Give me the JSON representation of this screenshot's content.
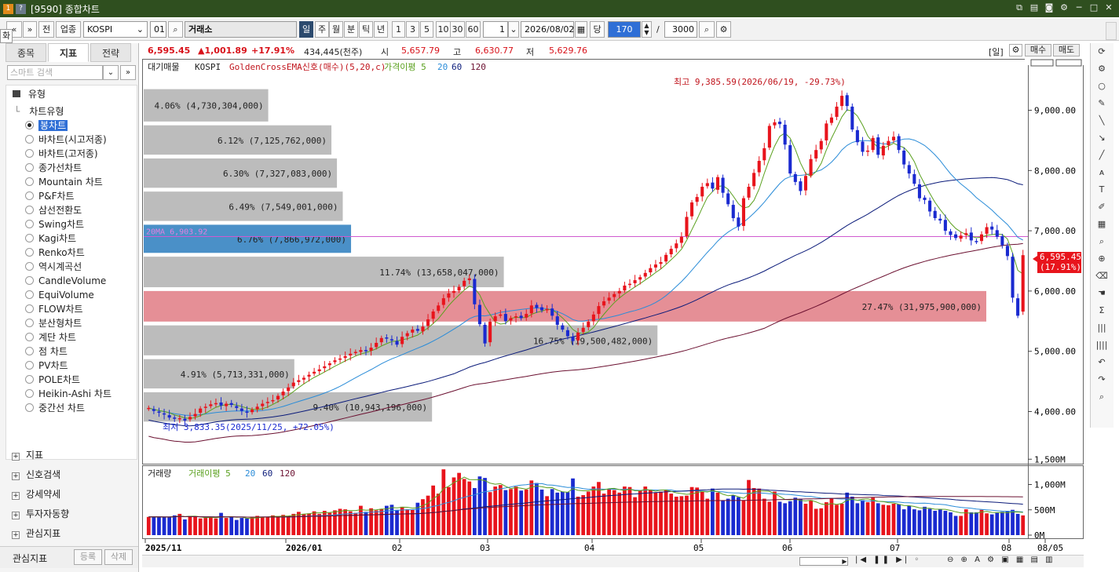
{
  "titlebar": {
    "badge1": "1",
    "badge2": "?",
    "title": "[9590] 종합차트"
  },
  "corner_tag": "화",
  "toolbar": {
    "nav_prev": "«",
    "nav_dropdown": "»",
    "btn_front": "전",
    "btn_industry": "업종",
    "symbol": "KOSPI",
    "symbol_no": "01",
    "exchange": "거래소",
    "periods": [
      "일",
      "주",
      "월",
      "분",
      "틱",
      "년"
    ],
    "intervals": [
      "1",
      "3",
      "5",
      "10",
      "30",
      "60"
    ],
    "count": "1",
    "date": "2026/08/02",
    "dang": "당",
    "view_count": "170",
    "slash": "/",
    "total": "3000"
  },
  "infobar": {
    "price": "6,595.45",
    "change": "▲1,001.89",
    "change_pct": "+17.91%",
    "volume": "434,445(천주)",
    "open_label": "시",
    "open": "5,657.79",
    "high_label": "고",
    "high": "6,630.77",
    "low_label": "저",
    "low": "5,629.76",
    "period_tag": "[일]",
    "buy_label": "매수",
    "sell_label": "매도"
  },
  "leftpanel": {
    "tabs": [
      "종목",
      "지표",
      "전략"
    ],
    "search_placeholder": "스마트 검색",
    "section_type": "유형",
    "tree_header": "차트유형",
    "chart_types": [
      "봉차트",
      "바차트(시고저종)",
      "바차트(고저종)",
      "종가선차트",
      "Mountain 차트",
      "P&F차트",
      "삼선전환도",
      "Swing차트",
      "Kagi차트",
      "Renko차트",
      "역시계곡선",
      "CandleVolume",
      "EquiVolume",
      "FLOW차트",
      "분산형차트",
      "계단 차트",
      "점 차트",
      "PV차트",
      "POLE차트",
      "Heikin-Ashi 차트",
      "중간선 차트"
    ],
    "sections": [
      "지표",
      "신호검색",
      "강세약세",
      "투자자동향",
      "관심지표"
    ],
    "fav_label": "관심지표",
    "btn_register": "등록",
    "btn_delete": "삭제"
  },
  "chart_data": [
    {
      "type": "candlestick",
      "legend": [
        "대기매물",
        "KOSPI",
        "GoldenCrossEMA신호(매수)(5,20,c)",
        "가격이평 5",
        "20",
        "60",
        "120"
      ],
      "colors": {
        "up": "#e8141c",
        "down": "#1a2ad0",
        "ma5": "#5aa01e",
        "ma20": "#2a8cd8",
        "ma60": "#0b1b7a",
        "ma120": "#6b1030",
        "hline": "#d05ad0"
      },
      "y_ticks": [
        "9,000.00",
        "8,000.00",
        "7,000.00",
        "6,000.00",
        "5,000.00",
        "4,000.00"
      ],
      "y_values": [
        9000,
        8000,
        7000,
        6000,
        5000,
        4000
      ],
      "x_labels": [
        "2025/11",
        "2026/01",
        "02",
        "03",
        "04",
        "05",
        "06",
        "07",
        "08",
        "08/05"
      ],
      "max_annotation": "최고 9,385.59(2026/06/19, -29.73%)",
      "min_annotation": "최저 3,833.35(2025/11/25, +72.05%)",
      "ma20_label": "20MA 6,903.92",
      "last_price_tag": "6,595.45",
      "last_pct_tag": "(17.91%)",
      "volume_profile": [
        {
          "label": "4.06% (4,730,304,000)",
          "lo": 8800,
          "hi": 9350,
          "pct": 4.06
        },
        {
          "label": "6.12% (7,125,762,000)",
          "lo": 8250,
          "hi": 8750,
          "pct": 6.12
        },
        {
          "label": "6.30% (7,327,083,000)",
          "lo": 7700,
          "hi": 8200,
          "pct": 6.3
        },
        {
          "label": "6.49% (7,549,001,000)",
          "lo": 7150,
          "hi": 7650,
          "pct": 6.49
        },
        {
          "label": "6.76% (7,866,972,000)",
          "lo": 6620,
          "hi": 7100,
          "pct": 6.76
        },
        {
          "label": "11.74% (13,658,047,000)",
          "lo": 6050,
          "hi": 6570,
          "pct": 11.74
        },
        {
          "label": "27.47% (31,975,900,000)",
          "lo": 5480,
          "hi": 6000,
          "pct": 27.47
        },
        {
          "label": "16.75% (19,500,482,000)",
          "lo": 4920,
          "hi": 5430,
          "pct": 16.75
        },
        {
          "label": "4.91% (5,713,331,000)",
          "lo": 4370,
          "hi": 4870,
          "pct": 4.91
        },
        {
          "label": "9.40% (10,943,196,000)",
          "lo": 3820,
          "hi": 4320,
          "pct": 9.4
        }
      ],
      "closes": [
        4060,
        4010,
        3980,
        3950,
        3900,
        3880,
        3890,
        3850,
        3910,
        3960,
        4050,
        4080,
        4120,
        4140,
        4100,
        4130,
        4110,
        4060,
        4010,
        3980,
        4030,
        4080,
        4130,
        4160,
        4190,
        4260,
        4330,
        4400,
        4480,
        4520,
        4560,
        4610,
        4660,
        4700,
        4750,
        4800,
        4850,
        4880,
        4920,
        4960,
        4990,
        5020,
        5000,
        5060,
        5140,
        5220,
        5210,
        5180,
        5110,
        5240,
        5300,
        5360,
        5340,
        5410,
        5530,
        5660,
        5760,
        5880,
        5960,
        6000,
        6070,
        6170,
        6210,
        5780,
        5450,
        5130,
        5490,
        5580,
        5610,
        5500,
        5550,
        5580,
        5550,
        5620,
        5760,
        5720,
        5680,
        5700,
        5590,
        5440,
        5360,
        5250,
        5170,
        5310,
        5390,
        5490,
        5610,
        5750,
        5830,
        5890,
        5950,
        6000,
        6090,
        6120,
        6180,
        6230,
        6300,
        6380,
        6440,
        6480,
        6600,
        6700,
        6790,
        6900,
        7230,
        7470,
        7560,
        7730,
        7790,
        7700,
        7890,
        7630,
        7440,
        7210,
        7070,
        7540,
        7730,
        7960,
        8160,
        8370,
        8740,
        8800,
        8770,
        8430,
        7950,
        7810,
        7660,
        7910,
        8190,
        8340,
        8490,
        8780,
        8880,
        9060,
        9240,
        9070,
        8680,
        8470,
        8310,
        8330,
        8540,
        8260,
        8410,
        8490,
        8560,
        8340,
        8100,
        7950,
        7780,
        7540,
        7510,
        7320,
        7210,
        7170,
        7000,
        6930,
        6880,
        6920,
        6960,
        6840,
        6820,
        6940,
        7060,
        7020,
        6900,
        6760,
        6580,
        5890,
        5590,
        6595
      ],
      "opens": [
        4050,
        4040,
        4000,
        3970,
        3940,
        3900,
        3880,
        3880,
        3870,
        3920,
        3980,
        4060,
        4090,
        4130,
        4150,
        4090,
        4140,
        4090,
        4050,
        4000,
        3990,
        4040,
        4090,
        4140,
        4170,
        4200,
        4270,
        4340,
        4420,
        4490,
        4530,
        4580,
        4630,
        4670,
        4720,
        4770,
        4820,
        4860,
        4890,
        4930,
        4970,
        4990,
        5020,
        5010,
        5070,
        5150,
        5230,
        5200,
        5170,
        5120,
        5250,
        5310,
        5370,
        5330,
        5420,
        5540,
        5670,
        5770,
        5890,
        5970,
        6010,
        6080,
        6180,
        6200,
        5770,
        5440,
        5150,
        5500,
        5590,
        5620,
        5510,
        5560,
        5590,
        5560,
        5630,
        5770,
        5730,
        5690,
        5710,
        5580,
        5430,
        5350,
        5240,
        5180,
        5320,
        5400,
        5500,
        5620,
        5760,
        5840,
        5900,
        5960,
        6010,
        6100,
        6130,
        6190,
        6240,
        6310,
        6390,
        6450,
        6490,
        6610,
        6710,
        6800,
        6910,
        7240,
        7480,
        7570,
        7740,
        7800,
        7680,
        7880,
        7620,
        7430,
        7220,
        7080,
        7550,
        7740,
        7970,
        8170,
        8380,
        8750,
        8810,
        8760,
        8420,
        7940,
        7820,
        7670,
        7920,
        8200,
        8350,
        8500,
        8790,
        8890,
        9070,
        9250,
        9060,
        8670,
        8480,
        8320,
        8340,
        8550,
        8250,
        8420,
        8500,
        8570,
        8330,
        8090,
        7940,
        7770,
        7550,
        7500,
        7330,
        7200,
        7180,
        6990,
        6940,
        6870,
        6930,
        6970,
        6830,
        6830,
        6950,
        7070,
        7010,
        6910,
        6750,
        6570,
        5880,
        5658
      ],
      "vol_bars": [
        360,
        360,
        360,
        350,
        360,
        390,
        420,
        310,
        380,
        370,
        330,
        340,
        350,
        330,
        440,
        340,
        360,
        300,
        340,
        330,
        360,
        380,
        360,
        360,
        390,
        360,
        400,
        380,
        420,
        460,
        420,
        430,
        470,
        420,
        480,
        440,
        490,
        520,
        510,
        470,
        440,
        580,
        460,
        530,
        490,
        520,
        580,
        600,
        500,
        560,
        510,
        500,
        640,
        710,
        780,
        980,
        820,
        1300,
        950,
        1140,
        1230,
        1110,
        1060,
        930,
        1160,
        1130,
        850,
        960,
        990,
        890,
        910,
        960,
        880,
        900,
        1080,
        1030,
        900,
        770,
        910,
        840,
        860,
        850,
        1120,
        760,
        790,
        860,
        960,
        1050,
        820,
        900,
        890,
        840,
        960,
        950,
        750,
        890,
        960,
        900,
        840,
        860,
        900,
        820,
        760,
        770,
        780,
        950,
        940,
        870,
        720,
        920,
        840,
        690,
        720,
        790,
        750,
        690,
        1090,
        930,
        920,
        720,
        660,
        860,
        660,
        630,
        670,
        740,
        720,
        620,
        690,
        520,
        530,
        650,
        730,
        600,
        620,
        840,
        760,
        630,
        690,
        650,
        740,
        630,
        600,
        590,
        620,
        610,
        510,
        580,
        510,
        490,
        560,
        520,
        480,
        510,
        480,
        450,
        380,
        380,
        510,
        450,
        450,
        500,
        430,
        410,
        440,
        460,
        470,
        500,
        420,
        390
      ],
      "vol_ticks": [
        "1,500M",
        "1,000M",
        "500M",
        "0M"
      ],
      "vol_tick_values": [
        1500,
        1000,
        500,
        0
      ],
      "vol_legend": [
        "거래량",
        "거래이평 5",
        "20",
        "60",
        "120"
      ]
    }
  ]
}
